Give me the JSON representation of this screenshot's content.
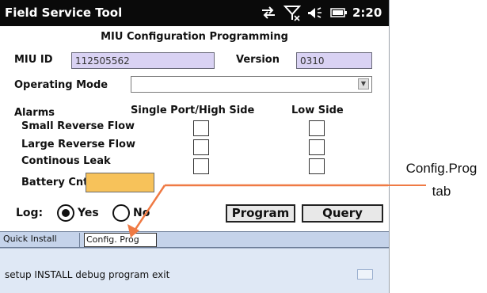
{
  "titlebar": {
    "app_title": "Field Service Tool",
    "time": "2:20",
    "icons": [
      "sync-icon",
      "signal-off-icon",
      "volume-icon",
      "battery-icon"
    ]
  },
  "form": {
    "title": "MIU Configuration Programming",
    "miu_id_label": "MIU ID",
    "miu_id_value": "112505562",
    "version_label": "Version",
    "version_value": "0310",
    "operating_mode_label": "Operating Mode",
    "operating_mode_value": "",
    "alarms_label": "Alarms",
    "single_port_label": "Single Port/High Side",
    "low_side_label": "Low Side",
    "alarm_rows": [
      "Small Reverse Flow",
      "Large Reverse Flow",
      "Continous Leak"
    ],
    "battery_label": "Battery Cnt",
    "log_label": "Log:",
    "log_yes": "Yes",
    "log_no": "No",
    "log_selected": "Yes",
    "program_button": "Program",
    "query_button": "Query"
  },
  "tabs": [
    "Quick Install",
    "Config. Prog"
  ],
  "active_tab": "Config. Prog",
  "menu": {
    "text": "setup INSTALL debug program exit"
  },
  "callout": {
    "line1": "Config.Prog",
    "line2": "tab"
  },
  "colors": {
    "titlebar_bg": "#0a0a0a",
    "field_bg": "#d9d2f3",
    "battery_field": "#f7c25a",
    "tabbar_bg": "#c5d3ea",
    "menubar_bg": "#dfe8f5",
    "callout_arrow": "#ef7a44"
  }
}
